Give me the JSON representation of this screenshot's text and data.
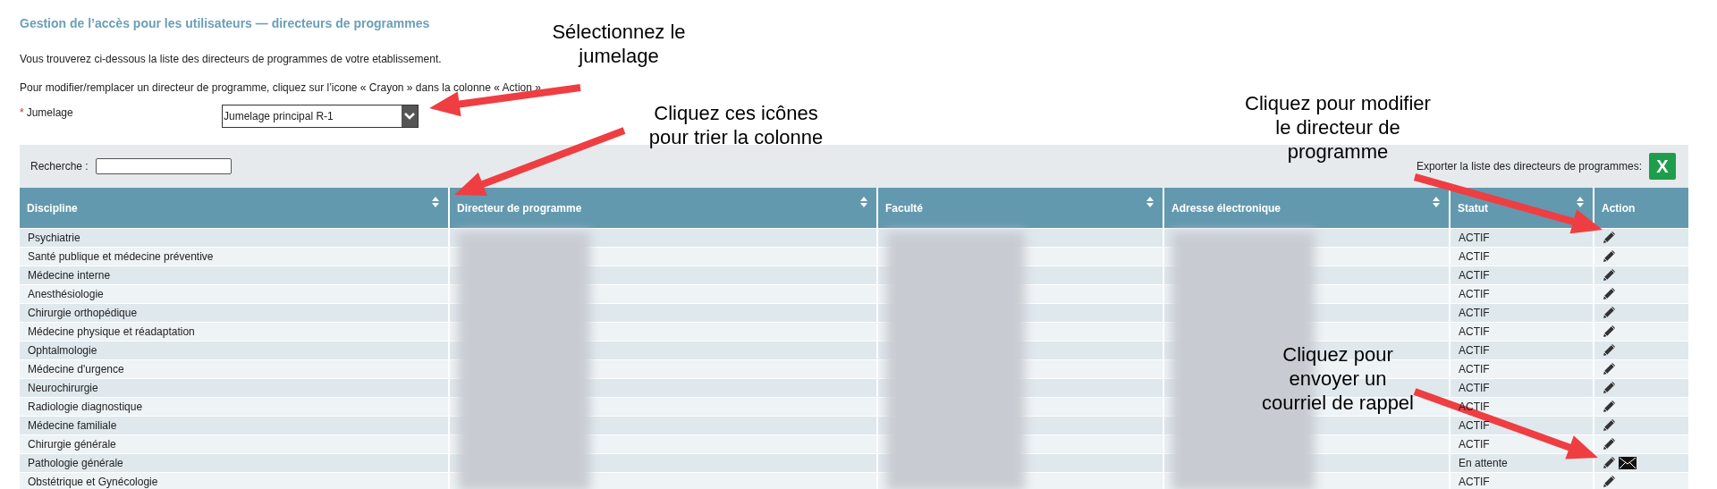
{
  "title": "Gestion de l’accès pour les utilisateurs — directeurs de programmes",
  "intro": [
    "Vous trouverez ci-dessous la liste des directeurs de programmes de votre etablissement.",
    "Pour modifier/remplacer un directeur de programme, cliquez sur l’icone « Crayon » dans la colonne « Action »."
  ],
  "jumelage": {
    "required_mark": "*",
    "label": "Jumelage",
    "value": "Jumelage principal R-1"
  },
  "search": {
    "label": "Recherche :"
  },
  "export": {
    "label": "Exporter la liste des directeurs de programmes:",
    "button": "X"
  },
  "columns": [
    {
      "label": "Discipline",
      "sortable": true
    },
    {
      "label": "Directeur de programme",
      "sortable": true
    },
    {
      "label": "Faculté",
      "sortable": true
    },
    {
      "label": "Adresse électronique",
      "sortable": true
    },
    {
      "label": "Statut",
      "sortable": true
    },
    {
      "label": "Action",
      "sortable": false
    }
  ],
  "rows": [
    {
      "discipline": "Psychiatrie",
      "status": "ACTIF",
      "reminder": false
    },
    {
      "discipline": "Santé publique et médecine préventive",
      "status": "ACTIF",
      "reminder": false
    },
    {
      "discipline": "Médecine interne",
      "status": "ACTIF",
      "reminder": false
    },
    {
      "discipline": "Anesthésiologie",
      "status": "ACTIF",
      "reminder": false
    },
    {
      "discipline": "Chirurgie orthopédique",
      "status": "ACTIF",
      "reminder": false
    },
    {
      "discipline": "Médecine physique et réadaptation",
      "status": "ACTIF",
      "reminder": false
    },
    {
      "discipline": "Ophtalmologie",
      "status": "ACTIF",
      "reminder": false
    },
    {
      "discipline": "Médecine d'urgence",
      "status": "ACTIF",
      "reminder": false
    },
    {
      "discipline": "Neurochirurgie",
      "status": "ACTIF",
      "reminder": false
    },
    {
      "discipline": "Radiologie diagnostique",
      "status": "ACTIF",
      "reminder": false
    },
    {
      "discipline": "Médecine familiale",
      "status": "ACTIF",
      "reminder": false
    },
    {
      "discipline": "Chirurgie générale",
      "status": "ACTIF",
      "reminder": false
    },
    {
      "discipline": "Pathologie générale",
      "status": "En attente",
      "reminder": true
    },
    {
      "discipline": "Obstétrique et Gynécologie",
      "status": "ACTIF",
      "reminder": false
    }
  ],
  "annotations": [
    {
      "lines": [
        "Sélectionnez le",
        "jumelage"
      ]
    },
    {
      "lines": [
        "Cliquez ces icônes",
        "pour trier la colonne"
      ]
    },
    {
      "lines": [
        "Cliquez pour modifier",
        "le directeur de",
        "programme"
      ]
    },
    {
      "lines": [
        "Cliquez pour",
        "envoyer un",
        "courriel de rappel"
      ]
    }
  ]
}
